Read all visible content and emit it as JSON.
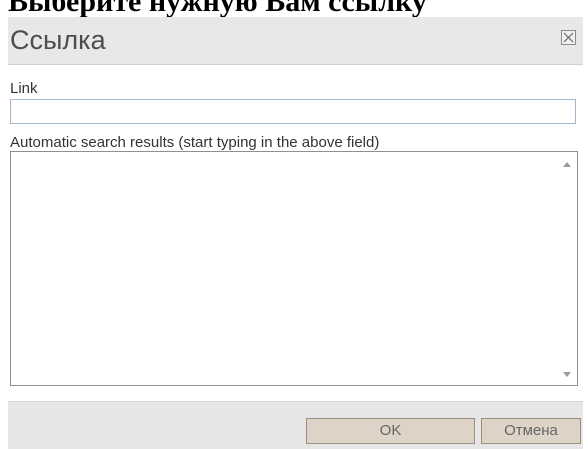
{
  "background": {
    "document_text": "Выберите нужную Вам ссылку"
  },
  "dialog": {
    "title": "Ссылка",
    "close_icon": "close-box-icon",
    "link_label": "Link",
    "link_value": "",
    "results_label": "Automatic search results (start typing in the above field)",
    "ok_label": "OK",
    "cancel_label": "Отмена"
  },
  "colors": {
    "titlebar": "#e8e8e8",
    "footer": "#e6e6e6",
    "button": "#ddd3c6",
    "input_border": "#a4b6cb"
  }
}
